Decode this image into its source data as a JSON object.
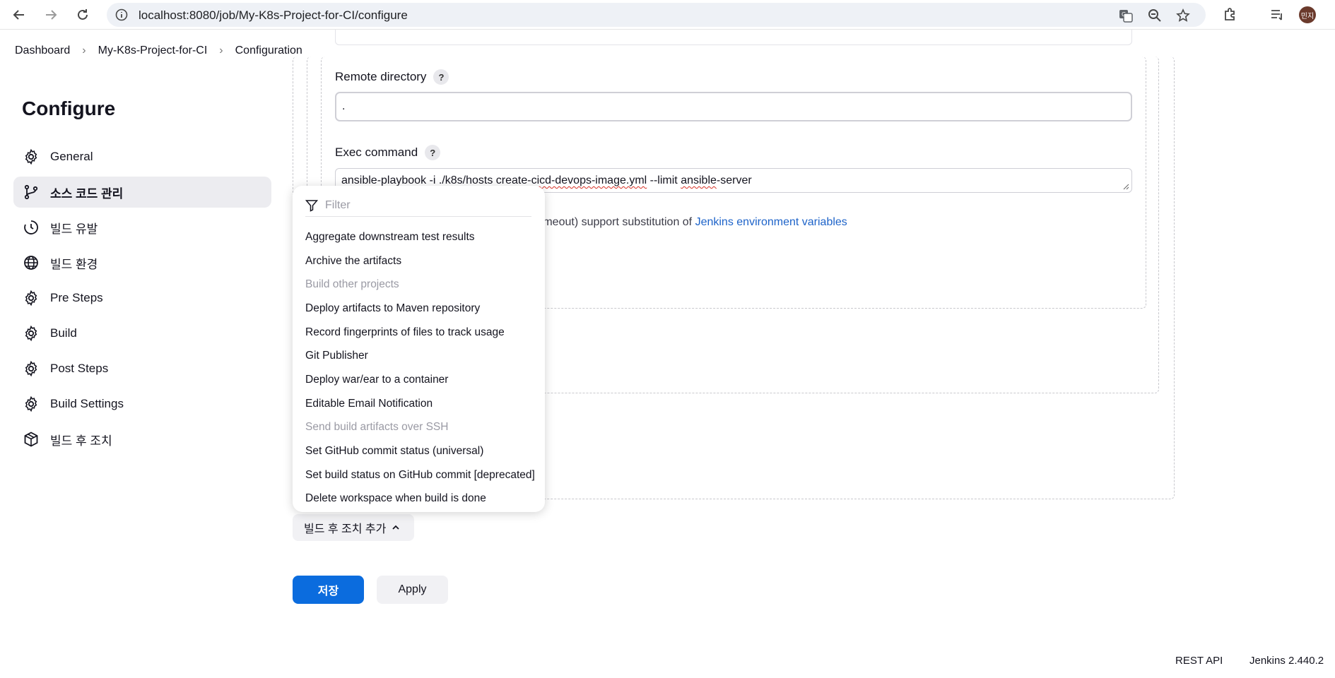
{
  "browser": {
    "url": "localhost:8080/job/My-K8s-Project-for-CI/configure",
    "avatar_text": "민지",
    "icons": [
      "back-arrow-icon",
      "forward-arrow-icon",
      "reload-icon",
      "site-info-icon",
      "translate-icon",
      "zoom-icon",
      "bookmark-star-icon",
      "extensions-icon",
      "reading-list-icon"
    ]
  },
  "breadcrumb": [
    "Dashboard",
    "My-K8s-Project-for-CI",
    "Configuration"
  ],
  "sidebar": {
    "title": "Configure",
    "items": [
      {
        "label": "General",
        "icon": "gear-icon"
      },
      {
        "label": "소스 코드 관리",
        "icon": "git-branch-icon",
        "active": true
      },
      {
        "label": "빌드 유발",
        "icon": "clock-icon"
      },
      {
        "label": "빌드 환경",
        "icon": "globe-icon"
      },
      {
        "label": "Pre Steps",
        "icon": "gear-icon"
      },
      {
        "label": "Build",
        "icon": "gear-icon"
      },
      {
        "label": "Post Steps",
        "icon": "gear-icon"
      },
      {
        "label": "Build Settings",
        "icon": "gear-icon"
      },
      {
        "label": "빌드 후 조치",
        "icon": "package-icon"
      }
    ]
  },
  "form": {
    "remote_directory": {
      "label": "Remote directory",
      "help": "?",
      "value": "."
    },
    "exec_command": {
      "label": "Exec command",
      "help": "?",
      "value_parts": [
        "ansible-playbook ",
        "-i",
        " ./k8s/hosts ",
        "create-cicd-devops-image.yml",
        " --limit ",
        "ansible",
        "-server"
      ]
    },
    "help_text_prefix": "xec timeout) support substitution of ",
    "help_link": "Jenkins environment variables"
  },
  "dropdown": {
    "filter_placeholder": "Filter",
    "items": [
      {
        "label": "Aggregate downstream test results",
        "enabled": true
      },
      {
        "label": "Archive the artifacts",
        "enabled": true
      },
      {
        "label": "Build other projects",
        "enabled": false
      },
      {
        "label": "Deploy artifacts to Maven repository",
        "enabled": true
      },
      {
        "label": "Record fingerprints of files to track usage",
        "enabled": true
      },
      {
        "label": "Git Publisher",
        "enabled": true
      },
      {
        "label": "Deploy war/ear to a container",
        "enabled": true
      },
      {
        "label": "Editable Email Notification",
        "enabled": true
      },
      {
        "label": "Send build artifacts over SSH",
        "enabled": false
      },
      {
        "label": "Set GitHub commit status (universal)",
        "enabled": true
      },
      {
        "label": "Set build status on GitHub commit [deprecated]",
        "enabled": true
      },
      {
        "label": "Delete workspace when build is done",
        "enabled": true
      }
    ]
  },
  "buttons": {
    "add_post_build": "빌드 후 조치 추가",
    "save": "저장",
    "apply": "Apply"
  },
  "footer": {
    "rest_api": "REST API",
    "version": "Jenkins 2.440.2"
  },
  "colors": {
    "primary_button": "#0b6cde",
    "link": "#1d63c9",
    "active_sidebar_bg": "#ececf0",
    "disabled_text": "#9a9aa4"
  }
}
